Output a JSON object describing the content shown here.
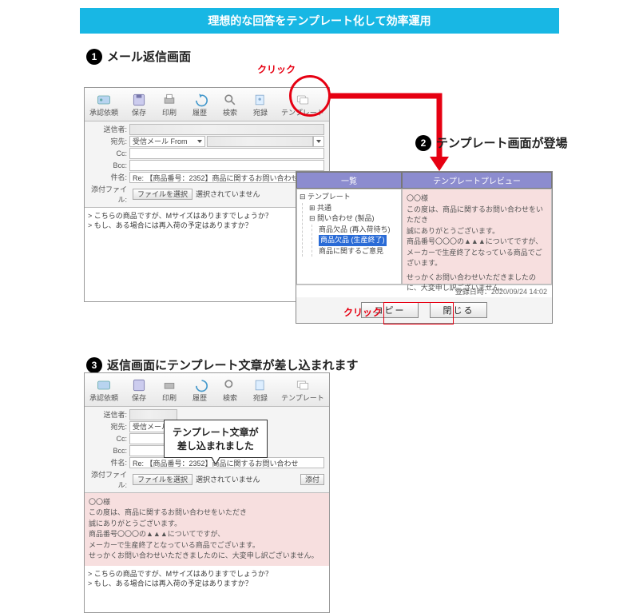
{
  "banner": "理想的な回答をテンプレート化して効率運用",
  "step1": {
    "num": "1",
    "title": "メール返信画面"
  },
  "step2": {
    "num": "2",
    "title": "テンプレート画面が登場"
  },
  "step3": {
    "num": "3",
    "title": "返信画面にテンプレート文章が差し込まれます"
  },
  "click_label": "クリック",
  "toolbar": {
    "approve": "承認依頼",
    "save": "保存",
    "print": "印刷",
    "undo": "履歴",
    "search": "検索",
    "addr": "宛録",
    "template": "テンプレート"
  },
  "compose": {
    "from_label": "送信者:",
    "from_value": "",
    "to_label": "宛先:",
    "to_select": "受信メール From",
    "cc_label": "Cc:",
    "cc_value": "",
    "bcc_label": "Bcc:",
    "bcc_value": "",
    "subject_label": "件名:",
    "subject_value": "Re: 【商品番号：2352】商品に関するお問い合わせ",
    "attach_label": "添付ファイル:",
    "attach_btn": "ファイルを選択",
    "attach_none": "選択されていません",
    "attach_add": "添付",
    "body_line1": "> こちらの商品ですが、Mサイズはありますでしょうか？",
    "body_line2": "> もし、ある場合には再入荷の予定はありますか？"
  },
  "template": {
    "list_head": "一覧",
    "preview_head": "テンプレートプレビュー",
    "tree_root": "テンプレート",
    "tree_common": "共通",
    "tree_inquiry": "問い合わせ (製品)",
    "tree_i1": "商品欠品 (再入荷待ち)",
    "tree_i2": "商品欠品 (生産終了)",
    "tree_i3": "商品に関するご意見",
    "preview_greet": "〇〇様",
    "preview_l1": "この度は、商品に関するお問い合わせをいただき",
    "preview_l2": "誠にありがとうございます。",
    "preview_l3": "商品番号〇〇〇の▲▲▲についてですが、",
    "preview_l4": "メーカーで生産終了となっている商品でございます。",
    "preview_l5": "せっかくお問い合わせいただきましたのに、大変申し訳ございません。",
    "timestamp_label": "登録日時：",
    "timestamp": "2020/09/24 14:02",
    "copy_btn": "コピー",
    "close_btn": "閉じる"
  },
  "speech": {
    "line1": "テンプレート文章が",
    "line2": "差し込まれました"
  }
}
